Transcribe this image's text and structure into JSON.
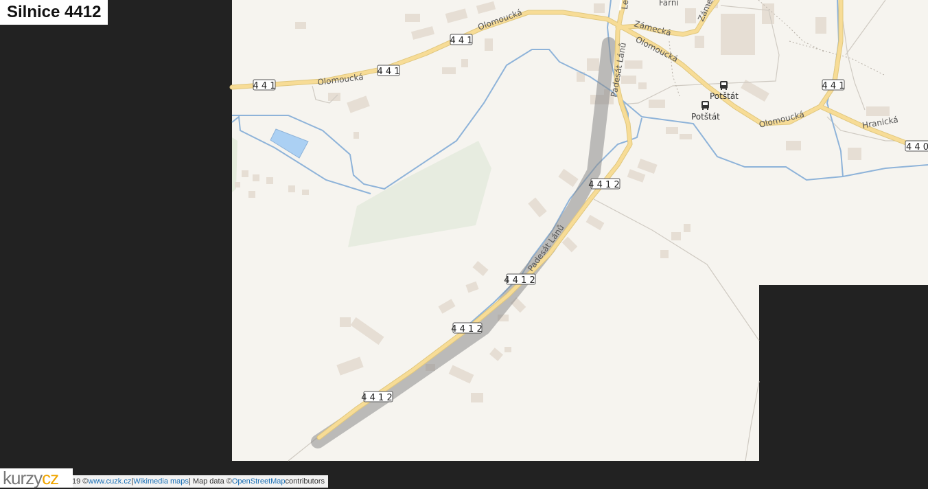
{
  "title": "Silnice 4412",
  "streets": {
    "olomoucka": "Olomoucká",
    "zamecka": "Zámecká",
    "padesat_lanu": "Padesát Lánů",
    "hranicka": "Hranická",
    "le_partial": "Le",
    "farni_partial": "Farní",
    "zamec_partial": "Zámec"
  },
  "road_shields": {
    "r441": "4 4 1",
    "r4412": "4 4 1 2",
    "r440": "4 4 0"
  },
  "bus_stops": [
    "Potštát",
    "Potštát"
  ],
  "attribution": {
    "prefix": "19 © ",
    "cuzk": "www.cuzk.cz",
    "sep1": " | ",
    "wikimedia": "Wikimedia maps",
    "mapdata": " | Map data © ",
    "osm": "OpenStreetMap",
    "suffix": " contributors"
  },
  "logo": {
    "part1": "kurzy",
    "part2": "cz"
  },
  "colors": {
    "map_bg": "#f6f4ef",
    "outside_bg": "#222222",
    "road_fill": "#f7dc96",
    "road_casing": "#e0c77e",
    "river": "#8eb3d9",
    "highlight": "#8a8a8a",
    "park": "#e7ece0",
    "building": "#e6ded4"
  }
}
